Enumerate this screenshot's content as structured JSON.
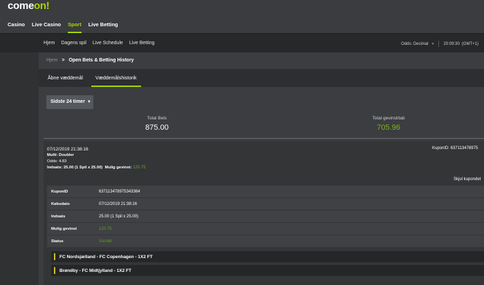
{
  "brand": {
    "logo_main": "come",
    "logo_accent": "on!",
    "accent_color": "#a6d608"
  },
  "main_nav": [
    {
      "label": "Casino"
    },
    {
      "label": "Live Casino"
    },
    {
      "label": "Sport",
      "active": true
    },
    {
      "label": "Live Betting"
    }
  ],
  "sub_nav": [
    {
      "label": "Hjem"
    },
    {
      "label": "Dagens spil"
    },
    {
      "label": "Live Schedule"
    },
    {
      "label": "Live Betting"
    }
  ],
  "settings": {
    "odds_label": "Odds: Decimal",
    "time_label": "20:09:30",
    "timezone_label": "(GMT+1)"
  },
  "breadcrumb": {
    "home": "Hjem",
    "sep": ">",
    "current": "Open Bets & Betting History"
  },
  "tabs": [
    {
      "label": "Åbne væddemål"
    },
    {
      "label": "Væddemålshistorik",
      "active": true
    }
  ],
  "filter": {
    "selected": "Sidste 24 timer"
  },
  "stats": {
    "total_bets_label": "Total Bets",
    "total_bets_value": "875.00",
    "total_win_label": "Total gevinst/tab",
    "total_win_value": "705.96"
  },
  "bet": {
    "date": "07/12/2019 21:38:16",
    "type": "Multi: Doubler",
    "odds": "Odds: 4.83",
    "stake_label": "Indsats: 25.00 (1 Spil x 25.00)",
    "possible_label": "Mulig gevinst:",
    "possible_value": "120.75",
    "kupon_right": "KuponID: 637113478975",
    "hide_label": "Skjul kupondet",
    "details": [
      {
        "key": "KuponID",
        "value": "637113478975343364"
      },
      {
        "key": "Købsdato",
        "value": "07/12/2019 21:38:16"
      },
      {
        "key": "Indsats",
        "value": "25.00 (1 Spil x 25.00)"
      },
      {
        "key": "Mulig gevinst",
        "value": "120.75"
      },
      {
        "key": "Status",
        "value": "Vundet"
      }
    ],
    "matches": [
      {
        "label": "FC Nordsjælland - FC Copenhagen - 1X2 FT"
      },
      {
        "label": "Brøndby - FC Midtjylland - 1X2 FT"
      }
    ]
  }
}
